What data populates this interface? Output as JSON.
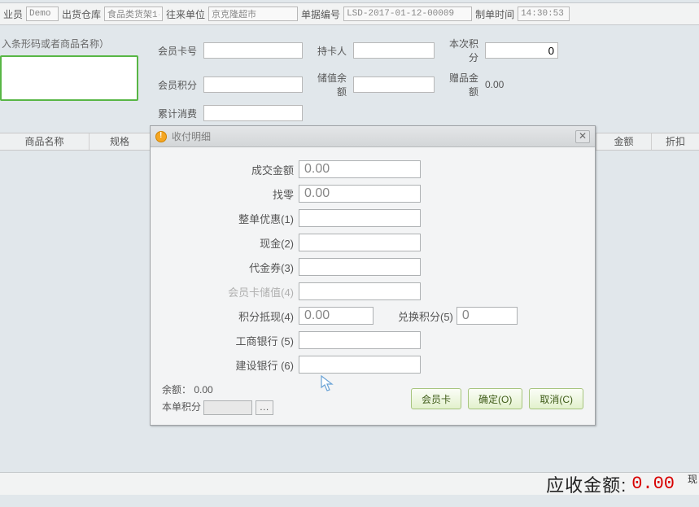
{
  "topbar": {
    "salesperson_label": "业员",
    "salesperson_value": "Demo",
    "warehouse_label": "出货仓库",
    "warehouse_value": "食品类货架1-",
    "partner_label": "往来单位",
    "partner_value": "京克隆超市",
    "docno_label": "单据编号",
    "docno_value": "LSD-2017-01-12-00009",
    "maketime_label": "制单时间",
    "maketime_value": "14:30:53"
  },
  "left": {
    "barcode_hint": "入条形码或者商品名称）"
  },
  "member": {
    "card_no_label": "会员卡号",
    "holder_label": "持卡人",
    "this_points_label": "本次积分",
    "this_points_value": "0",
    "points_label": "会员积分",
    "stored_balance_label": "储值余额",
    "gift_amount_label": "赠品金额",
    "gift_amount_value": "0.00",
    "total_spent_label": "累计消费"
  },
  "tablehdr": {
    "name": "商品名称",
    "spec": "规格",
    "amount": "金额",
    "discount": "折扣"
  },
  "dialog": {
    "title": "收付明细",
    "deal_amount_label": "成交金额",
    "deal_amount_value": "0.00",
    "change_label": "找零",
    "change_value": "0.00",
    "whole_discount_label": "整单优惠(1)",
    "cash_label": "现金(2)",
    "voucher_label": "代金券(3)",
    "card_stored_label": "会员卡储值(4)",
    "points_cash_label": "积分抵现(4)",
    "points_cash_value": "0.00",
    "exchange_points_label": "兑换积分(5)",
    "exchange_points_value": "0",
    "icbc_label": "工商银行 (5)",
    "ccb_label": "建设银行 (6)",
    "balance_label": "余额：",
    "balance_value": "0.00",
    "order_points_label": "本单积分",
    "btn_membercard": "会员卡",
    "btn_ok": "确定(O)",
    "btn_cancel": "取消(C)"
  },
  "bottom": {
    "due_label": "应收金额:",
    "due_value": "0.00",
    "side1": "现"
  }
}
